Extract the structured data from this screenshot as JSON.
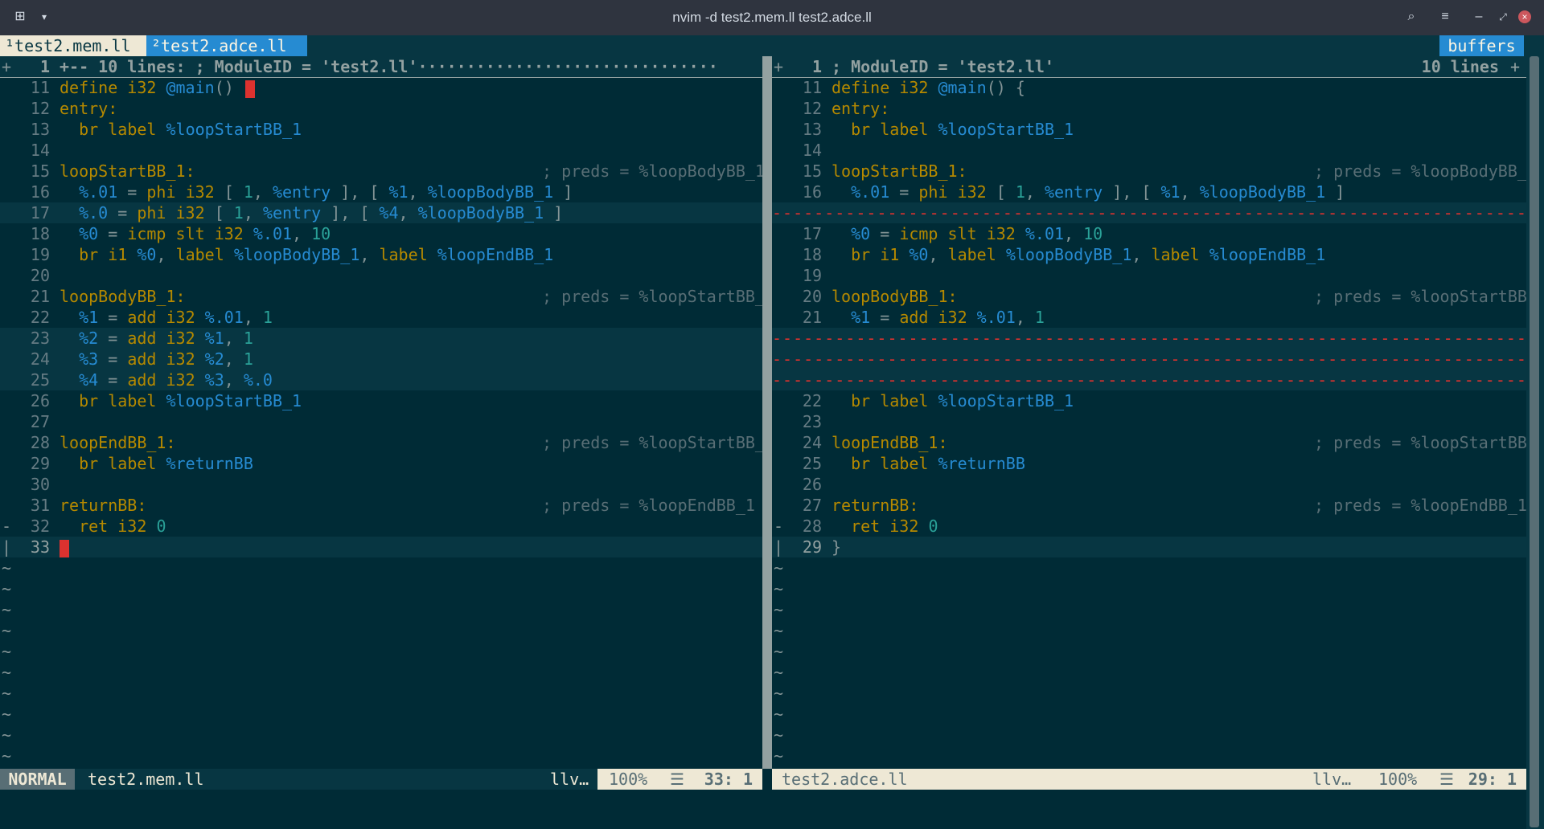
{
  "window": {
    "title": "nvim -d test2.mem.ll test2.adce.ll",
    "icons": [
      "new-tab-icon",
      "dropdown-icon",
      "search-icon",
      "menu-icon",
      "minimize-icon",
      "maximize-icon",
      "close-icon"
    ]
  },
  "tabline": {
    "tab1": "¹test2.mem.ll",
    "tab2": "²test2.adce.ll",
    "buffers": "buffers"
  },
  "left": {
    "fold": {
      "sign": "+",
      "num": "1",
      "text": "+-- 10 lines: ; ModuleID = 'test2.ll'·······························"
    },
    "lines": [
      {
        "n": "11",
        "sign": "",
        "text": "define i32 @main() "
      },
      {
        "n": "12",
        "sign": "",
        "text": "entry:"
      },
      {
        "n": "13",
        "sign": "",
        "text": "  br label %loopStartBB_1"
      },
      {
        "n": "14",
        "sign": "",
        "text": ""
      },
      {
        "n": "15",
        "sign": "",
        "text": "loopStartBB_1:",
        "preds": "; preds = %loopBodyBB_1"
      },
      {
        "n": "16",
        "sign": "",
        "text": "  %.01 = phi i32 [ 1, %entry ], [ %1, %loopBodyBB_1 ]"
      },
      {
        "n": "17",
        "sign": "",
        "text": "  %.0 = phi i32 [ 1, %entry ], [ %4, %loopBodyBB_1 ]"
      },
      {
        "n": "18",
        "sign": "",
        "text": "  %0 = icmp slt i32 %.01, 10"
      },
      {
        "n": "19",
        "sign": "",
        "text": "  br i1 %0, label %loopBodyBB_1, label %loopEndBB_1"
      },
      {
        "n": "20",
        "sign": "",
        "text": ""
      },
      {
        "n": "21",
        "sign": "",
        "text": "loopBodyBB_1:",
        "preds": "; preds = %loopStartBB_"
      },
      {
        "n": "22",
        "sign": "",
        "text": "  %1 = add i32 %.01, 1"
      },
      {
        "n": "23",
        "sign": "",
        "text": "  %2 = add i32 %1, 1"
      },
      {
        "n": "24",
        "sign": "",
        "text": "  %3 = add i32 %2, 1"
      },
      {
        "n": "25",
        "sign": "",
        "text": "  %4 = add i32 %3, %.0"
      },
      {
        "n": "26",
        "sign": "",
        "text": "  br label %loopStartBB_1"
      },
      {
        "n": "27",
        "sign": "",
        "text": ""
      },
      {
        "n": "28",
        "sign": "",
        "text": "loopEndBB_1:",
        "preds": "; preds = %loopStartBB_"
      },
      {
        "n": "29",
        "sign": "",
        "text": "  br label %returnBB"
      },
      {
        "n": "30",
        "sign": "",
        "text": ""
      },
      {
        "n": "31",
        "sign": "",
        "text": "returnBB:",
        "preds": "; preds = %loopEndBB_1"
      },
      {
        "n": "32",
        "sign": "-",
        "text": "  ret i32 0"
      },
      {
        "n": "33",
        "sign": "|",
        "text": ""
      }
    ]
  },
  "right": {
    "fold": {
      "sign": "+",
      "num": "1",
      "text": "; ModuleID = 'test2.ll'",
      "count": "10 lines",
      "plus": "+"
    },
    "lines": [
      {
        "n": "11",
        "sign": "",
        "text": "define i32 @main() {"
      },
      {
        "n": "12",
        "sign": "",
        "text": "entry:"
      },
      {
        "n": "13",
        "sign": "",
        "text": "  br label %loopStartBB_1"
      },
      {
        "n": "14",
        "sign": "",
        "text": ""
      },
      {
        "n": "15",
        "sign": "",
        "text": "loopStartBB_1:",
        "preds": "; preds = %loopBodyBB_"
      },
      {
        "n": "16",
        "sign": "",
        "text": "  %.01 = phi i32 [ 1, %entry ], [ %1, %loopBodyBB_1 ]"
      },
      {
        "n": "17",
        "sign": "",
        "text": "  %0 = icmp slt i32 %.01, 10"
      },
      {
        "n": "18",
        "sign": "",
        "text": "  br i1 %0, label %loopBodyBB_1, label %loopEndBB_1"
      },
      {
        "n": "19",
        "sign": "",
        "text": ""
      },
      {
        "n": "20",
        "sign": "",
        "text": "loopBodyBB_1:",
        "preds": "; preds = %loopStartBB"
      },
      {
        "n": "21",
        "sign": "",
        "text": "  %1 = add i32 %.01, 1"
      },
      {
        "n": "22",
        "sign": "",
        "text": "  br label %loopStartBB_1"
      },
      {
        "n": "23",
        "sign": "",
        "text": ""
      },
      {
        "n": "24",
        "sign": "",
        "text": "loopEndBB_1:",
        "preds": "; preds = %loopStartBB"
      },
      {
        "n": "25",
        "sign": "",
        "text": "  br label %returnBB"
      },
      {
        "n": "26",
        "sign": "",
        "text": ""
      },
      {
        "n": "27",
        "sign": "",
        "text": "returnBB:",
        "preds": "; preds = %loopEndBB_1"
      },
      {
        "n": "28",
        "sign": "-",
        "text": "  ret i32 0"
      },
      {
        "n": "29",
        "sign": "|",
        "text": "}"
      }
    ],
    "filler": "-----------------------------------------------------------------------------------------------------------------------------------------------------------------------------------"
  },
  "tilde": "~",
  "status_left": {
    "mode": "NORMAL",
    "file": "test2.mem.ll",
    "filetype": "llv…",
    "percent": "100%",
    "lines_icon": "☰",
    "pos": "33:  1"
  },
  "status_right": {
    "file": "test2.adce.ll",
    "filetype": "llv…",
    "percent": "100%",
    "lines_icon": "☰",
    "pos": "29:  1"
  },
  "colors": {
    "bg": "#002b36",
    "highlight": "#073642",
    "keyword": "#b58900",
    "identifier": "#268bd2",
    "number": "#2aa198",
    "delete": "#dc322f"
  }
}
